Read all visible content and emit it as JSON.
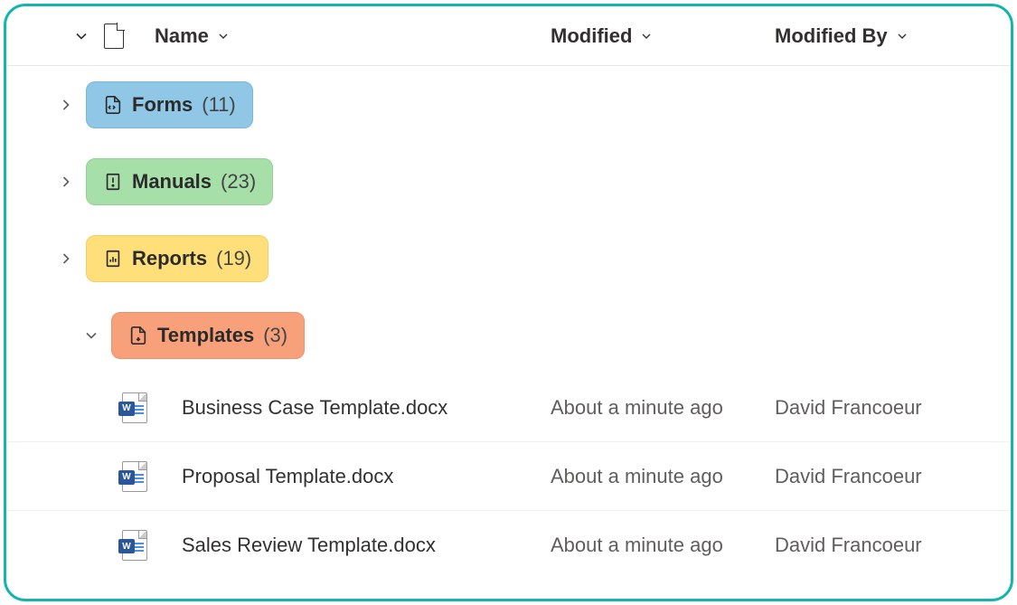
{
  "columns": {
    "name": "Name",
    "modified": "Modified",
    "modifiedBy": "Modified By"
  },
  "folders": [
    {
      "label": "Forms",
      "count": "(11)",
      "color": "blue",
      "expanded": false
    },
    {
      "label": "Manuals",
      "count": "(23)",
      "color": "green",
      "expanded": false
    },
    {
      "label": "Reports",
      "count": "(19)",
      "color": "yellow",
      "expanded": false
    },
    {
      "label": "Templates",
      "count": "(3)",
      "color": "orange",
      "expanded": true
    }
  ],
  "files": [
    {
      "name": "Business Case Template.docx",
      "modified": "About a minute ago",
      "author": "David Francoeur"
    },
    {
      "name": "Proposal Template.docx",
      "modified": "About a minute ago",
      "author": "David Francoeur"
    },
    {
      "name": "Sales Review Template.docx",
      "modified": "About a minute ago",
      "author": "David Francoeur"
    }
  ]
}
